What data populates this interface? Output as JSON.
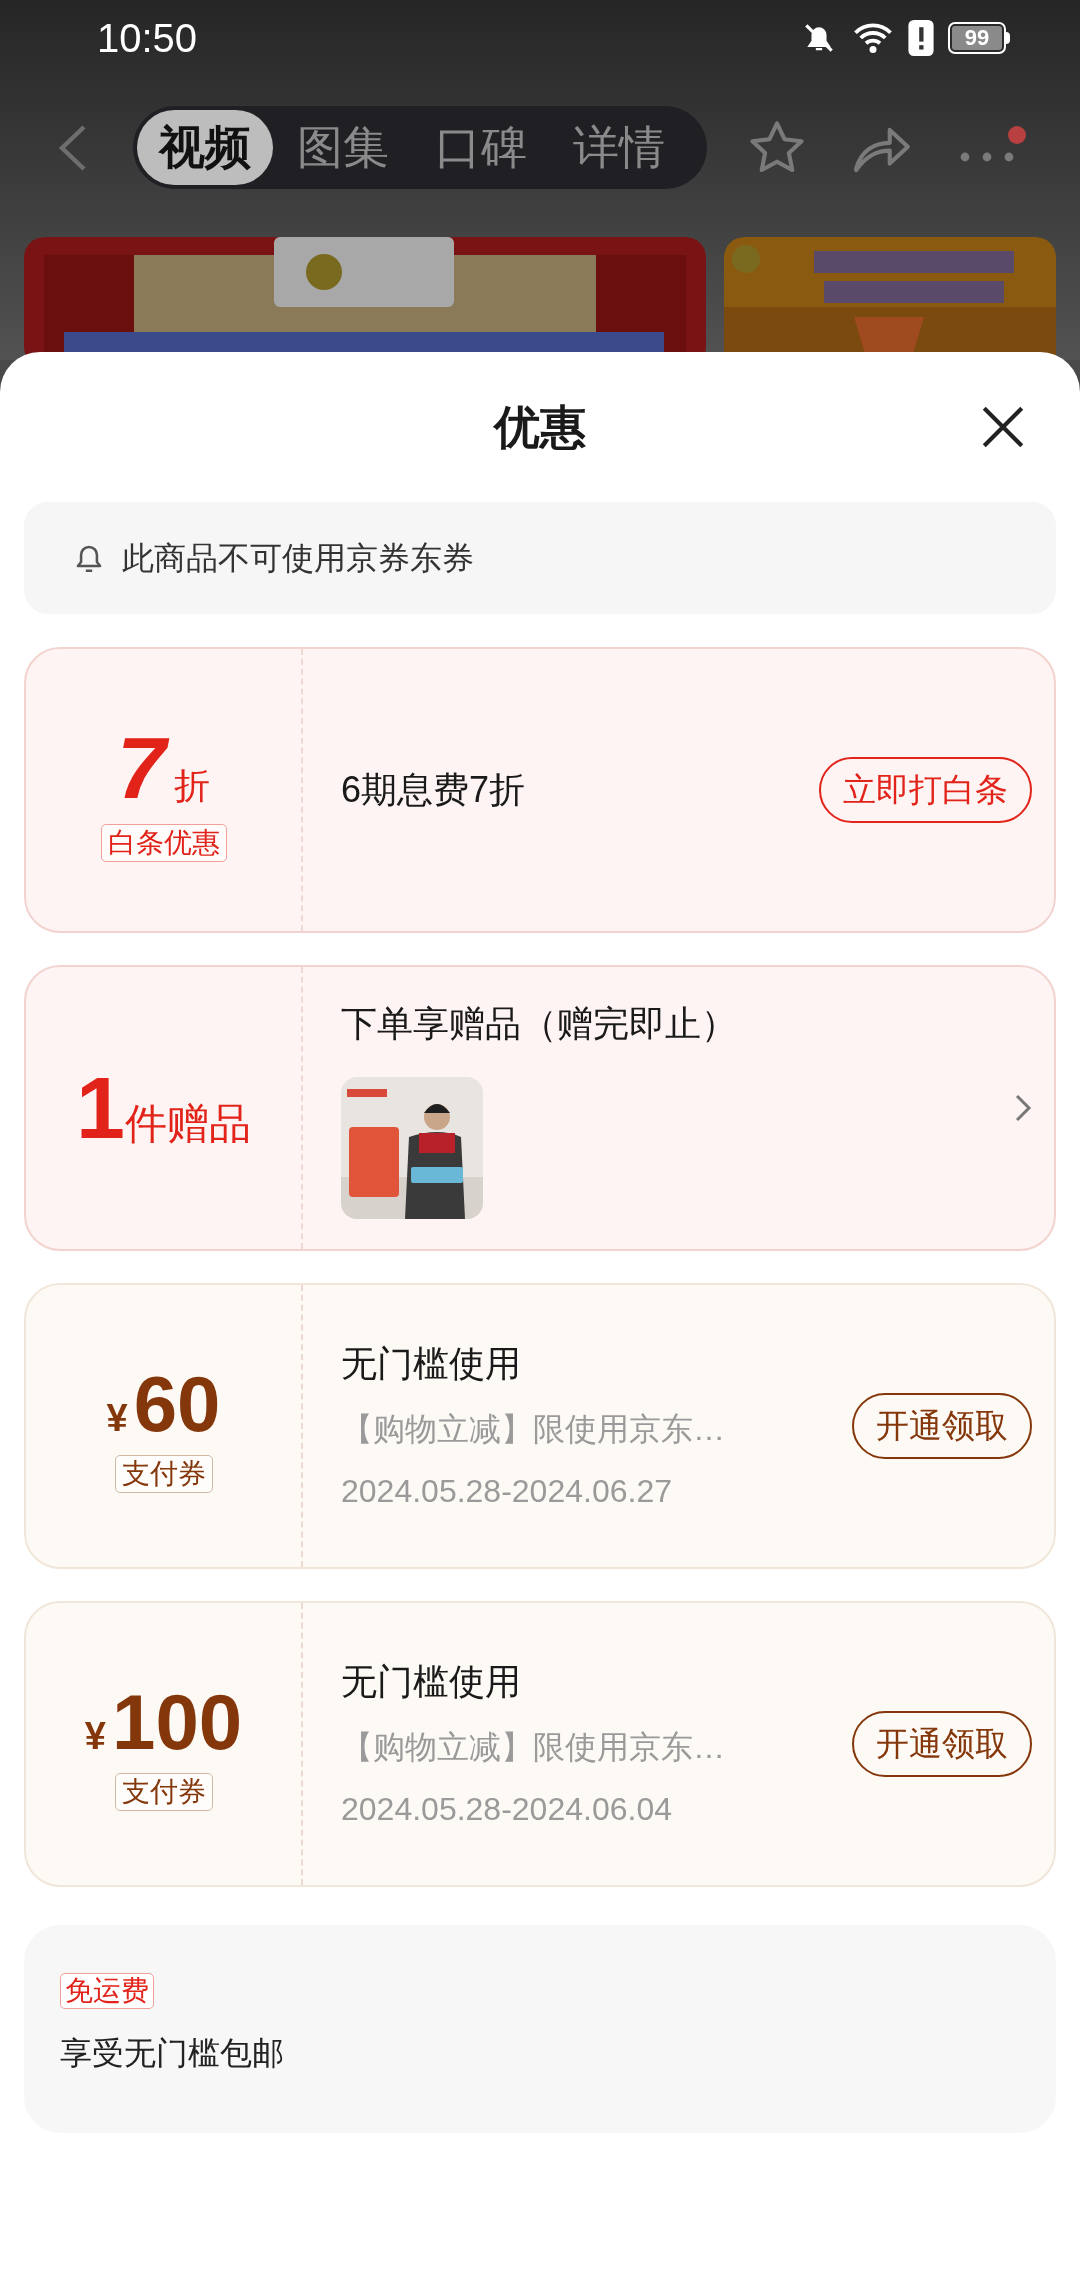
{
  "status_bar": {
    "time": "10:50",
    "battery": "99"
  },
  "nav": {
    "tabs": [
      {
        "label": "视频",
        "selected": true
      },
      {
        "label": "图集",
        "selected": false
      },
      {
        "label": "口碑",
        "selected": false
      },
      {
        "label": "详情",
        "selected": false
      }
    ]
  },
  "sheet": {
    "title": "优惠",
    "notice": "此商品不可使用京券东券",
    "offers": [
      {
        "kind": "discount",
        "amount": "7",
        "unit": "折",
        "badge": "白条优惠",
        "title": "6期息费7折",
        "action": "立即打白条"
      },
      {
        "kind": "gift",
        "amount": "1",
        "unit": "件赠品",
        "title": "下单享赠品（赠完即止）"
      },
      {
        "kind": "coupon",
        "currency": "¥",
        "amount": "60",
        "badge": "支付券",
        "title": "无门槛使用",
        "description": "【购物立减】限使用京东…",
        "period": "2024.05.28-2024.06.27",
        "action": "开通领取"
      },
      {
        "kind": "coupon",
        "currency": "¥",
        "amount": "100",
        "badge": "支付券",
        "title": "无门槛使用",
        "description": "【购物立减】限使用京东…",
        "period": "2024.05.28-2024.06.04",
        "action": "开通领取"
      }
    ],
    "shipping": {
      "badge": "免运费",
      "text": "享受无门槛包邮"
    }
  }
}
